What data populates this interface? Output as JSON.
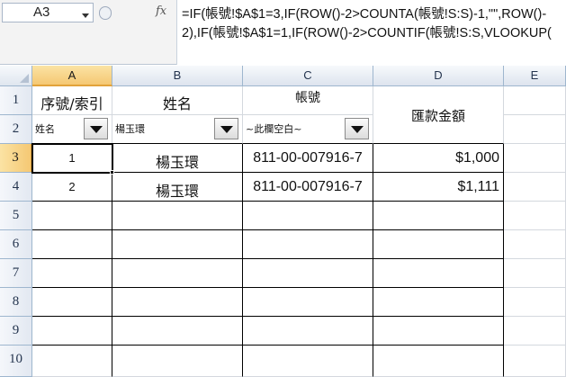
{
  "formula_bar": {
    "name_box": "A3",
    "fx_label": "fx",
    "formula_line1": "=IF(帳號!$A$1=3,IF(ROW()-2>COUNTA(帳號!S:S)-1,\"\",ROW()-",
    "formula_line2": "2),IF(帳號!$A$1=1,IF(ROW()-2>COUNTIF(帳號!S:S,VLOOKUP("
  },
  "columns": [
    "A",
    "B",
    "C",
    "D",
    "E"
  ],
  "rows": [
    "1",
    "2",
    "3",
    "4",
    "5",
    "6",
    "7",
    "8",
    "9",
    "10"
  ],
  "selected_cell": "A3",
  "sheet": {
    "header": {
      "a1": "序號/索引",
      "b1": "姓名",
      "c1": "帳號",
      "d1": "匯款金額"
    },
    "filters": {
      "a2": "姓名",
      "b2": "楊玉環",
      "c2": "~此欄空白~"
    },
    "data": [
      {
        "seq": "1",
        "name": "楊玉環",
        "account": "811-00-007916-7",
        "amount": "$1,000"
      },
      {
        "seq": "2",
        "name": "楊玉環",
        "account": "811-00-007916-7",
        "amount": "$1,111"
      }
    ]
  }
}
